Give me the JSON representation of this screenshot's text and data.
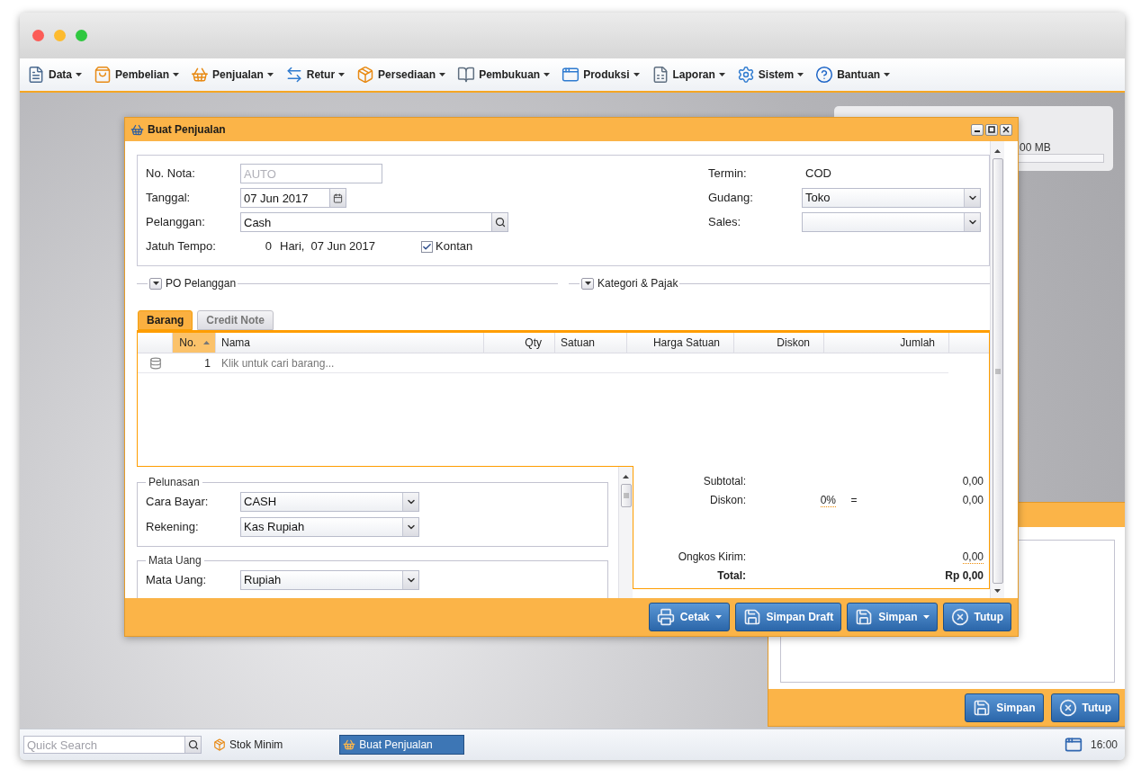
{
  "menu": [
    {
      "label": "Data"
    },
    {
      "label": "Pembelian"
    },
    {
      "label": "Penjualan"
    },
    {
      "label": "Retur"
    },
    {
      "label": "Persediaan"
    },
    {
      "label": "Pembukuan"
    },
    {
      "label": "Produksi"
    },
    {
      "label": "Laporan"
    },
    {
      "label": "Sistem"
    },
    {
      "label": "Bantuan"
    }
  ],
  "memory_widget": {
    "reading": "00 MB",
    "level": 0
  },
  "sales_window": {
    "title": "Buat Penjualan",
    "header_left": [
      {
        "kind": "placeholder",
        "label": "No. Nota:",
        "placeholder": "AUTO"
      },
      {
        "kind": "date",
        "label": "Tanggal:",
        "value": "07 Jun 2017"
      },
      {
        "kind": "search",
        "label": "Pelanggan:",
        "value": "Cash"
      },
      {
        "kind": "due",
        "label": "Jatuh Tempo:",
        "days": "0",
        "unit": "Hari,",
        "date": "07 Jun 2017",
        "checkbox": {
          "label": "Kontan",
          "checked": true
        }
      }
    ],
    "header_right": [
      {
        "kind": "static",
        "label": "Termin:",
        "value": "COD"
      },
      {
        "kind": "select",
        "label": "Gudang:",
        "value": "Toko"
      },
      {
        "kind": "select",
        "label": "Sales:"
      }
    ],
    "sections": [
      {
        "label": "PO Pelanggan",
        "expanded": false
      },
      {
        "label": "Kategori & Pajak",
        "expanded": false
      }
    ],
    "tabs": [
      {
        "label": "Barang",
        "selected": true
      },
      {
        "label": "Credit Note",
        "selected": false
      }
    ],
    "table": {
      "columns": [
        {
          "label": "No.",
          "sorted": true
        },
        {
          "label": "Nama",
          "sorted": false
        },
        {
          "label": "Qty",
          "sorted": false
        },
        {
          "label": "Satuan",
          "sorted": false
        },
        {
          "label": "Harga Satuan",
          "sorted": false
        },
        {
          "label": "Diskon",
          "sorted": false
        },
        {
          "label": "Jumlah",
          "sorted": false
        }
      ],
      "rows": [
        {
          "no": "1",
          "nama": "Klik untuk cari barang..."
        }
      ]
    },
    "groups": [
      {
        "legend": "Pelunasan",
        "fields": [
          {
            "label": "Cara Bayar:",
            "value": "CASH"
          },
          {
            "label": "Rekening:",
            "value": "Kas Rupiah"
          }
        ]
      },
      {
        "legend": "Mata Uang",
        "fields": [
          {
            "label": "Mata Uang:",
            "value": "Rupiah"
          }
        ]
      }
    ],
    "summary": {
      "subtotal": {
        "label": "Subtotal:",
        "value": "0,00"
      },
      "discount": {
        "label": "Diskon:",
        "percent": "0%",
        "equals": "=",
        "value": "0,00"
      },
      "shipping": {
        "label": "Ongkos Kirim:",
        "value": "0,00"
      },
      "total": {
        "label": "Total:",
        "value": "Rp 0,00"
      }
    },
    "buttons": [
      {
        "label": "Cetak",
        "kind": "print",
        "dropdown": true
      },
      {
        "label": "Simpan Draft",
        "kind": "save",
        "dropdown": false
      },
      {
        "label": "Simpan",
        "kind": "save",
        "dropdown": true
      },
      {
        "label": "Tutup",
        "kind": "close",
        "dropdown": false
      }
    ]
  },
  "back_window": {
    "buttons": [
      {
        "label": "Simpan",
        "kind": "save",
        "dropdown": false
      },
      {
        "label": "Tutup",
        "kind": "close",
        "dropdown": false
      }
    ]
  },
  "taskbar": {
    "search": {
      "placeholder": "Quick Search"
    },
    "items": [
      {
        "label": "Stok Minim",
        "selected": false
      },
      {
        "label": "Buat Penjualan",
        "selected": true
      }
    ],
    "clock": "16:00"
  }
}
